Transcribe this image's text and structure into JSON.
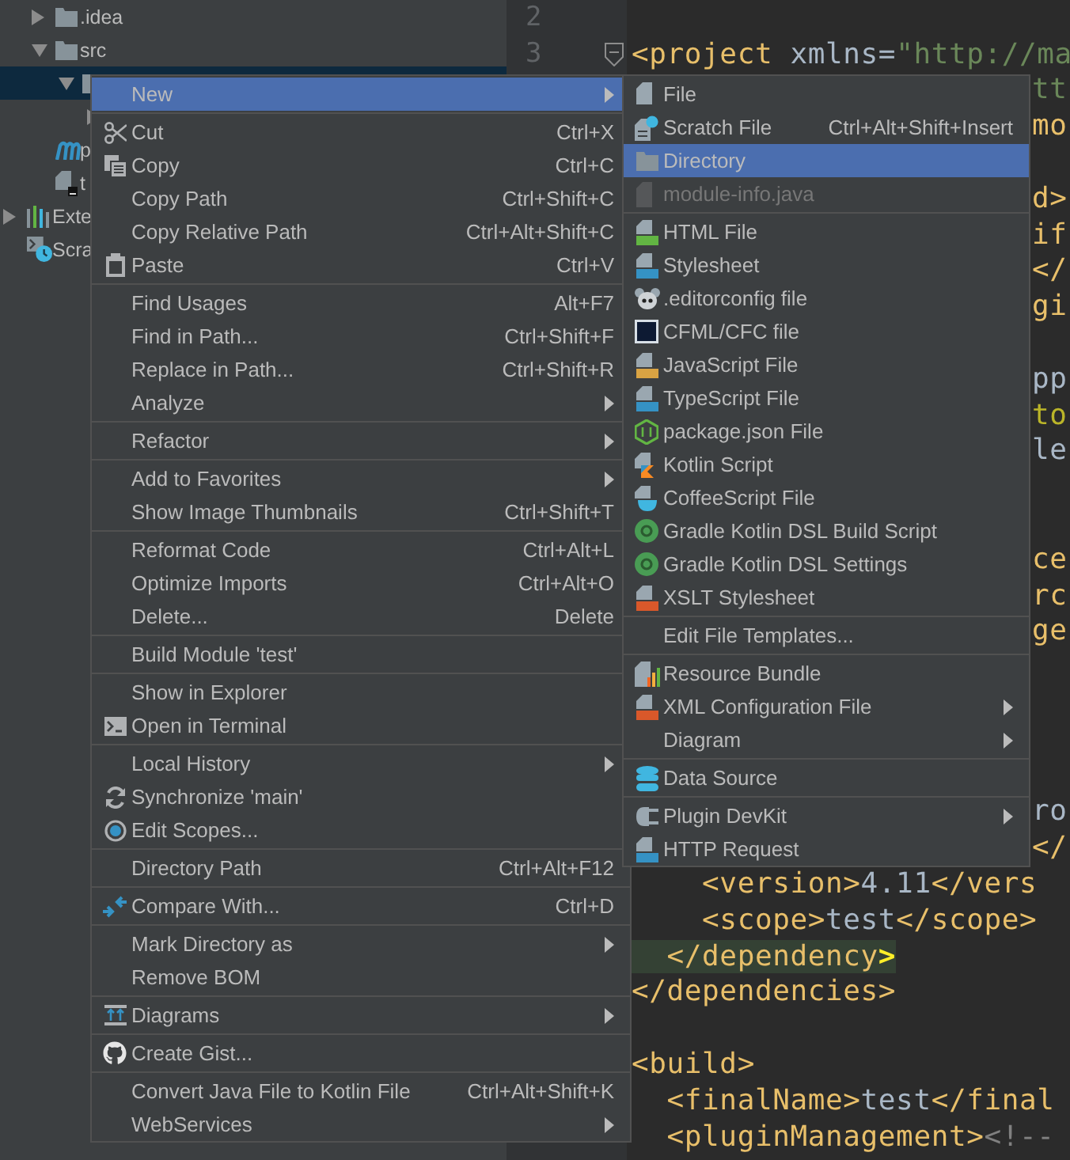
{
  "project_tree": {
    "items": [
      {
        "label": ".idea",
        "kind": "folder",
        "expanded": false,
        "selected": false
      },
      {
        "label": "src",
        "kind": "folder",
        "expanded": true,
        "selected": false,
        "children": [
          {
            "kind": "folder",
            "expanded": true,
            "selected": true,
            "children": [
              {
                "expanded": false,
                "selected": false
              }
            ]
          }
        ]
      },
      {
        "label": "p",
        "kind": "maven",
        "selected": false
      },
      {
        "label": "t",
        "kind": "module",
        "selected": false
      }
    ],
    "roots": [
      {
        "label": "Exte",
        "kind": "libraries",
        "expanded": false,
        "selected": false
      },
      {
        "label": "Scra",
        "kind": "scratches",
        "selected": false
      }
    ]
  },
  "editor": {
    "lines": [
      {
        "number": "2"
      },
      {
        "number": "3",
        "fold": true,
        "segments": [
          {
            "kind": "tag",
            "text": "<project"
          },
          {
            "kind": "text",
            "text": " xmlns="
          },
          {
            "kind": "string",
            "text": "\"http://ma"
          }
        ]
      },
      {
        "kind": "peek",
        "segments": [
          {
            "kind": "string",
            "text": "tt"
          }
        ]
      },
      {
        "kind": "peek",
        "segments": [
          {
            "kind": "tag",
            "text": "mo"
          }
        ]
      },
      {
        "kind": "blank"
      },
      {
        "kind": "peek",
        "segments": [
          {
            "kind": "tag",
            "text": "d>"
          }
        ]
      },
      {
        "kind": "peek",
        "segments": [
          {
            "kind": "tag",
            "text": "if"
          }
        ]
      },
      {
        "kind": "peek",
        "segments": [
          {
            "kind": "tag",
            "text": "</"
          }
        ]
      },
      {
        "kind": "peek",
        "segments": [
          {
            "kind": "tag",
            "text": "gi"
          }
        ]
      },
      {
        "kind": "blank"
      },
      {
        "kind": "peek",
        "segments": [
          {
            "kind": "text",
            "text": "pp"
          }
        ]
      },
      {
        "kind": "peek",
        "segments": [
          {
            "kind": "entity",
            "text": "to"
          }
        ]
      },
      {
        "kind": "peek",
        "segments": [
          {
            "kind": "text",
            "text": "le"
          }
        ]
      },
      {
        "kind": "blank"
      },
      {
        "kind": "blank"
      },
      {
        "kind": "peek",
        "segments": [
          {
            "kind": "tag",
            "text": "ce"
          }
        ]
      },
      {
        "kind": "peek",
        "segments": [
          {
            "kind": "tag",
            "text": "rc"
          }
        ]
      },
      {
        "kind": "peek",
        "segments": [
          {
            "kind": "tag",
            "text": "ge"
          }
        ]
      },
      {
        "kind": "blank"
      },
      {
        "kind": "blank"
      },
      {
        "kind": "blank"
      },
      {
        "kind": "blank"
      },
      {
        "kind": "peek",
        "segments": [
          {
            "kind": "text",
            "text": "ro"
          }
        ]
      },
      {
        "kind": "peek",
        "segments": [
          {
            "kind": "tag",
            "text": "</"
          }
        ]
      },
      {
        "segments": [
          {
            "kind": "tag",
            "text": "    <version>"
          },
          {
            "kind": "text",
            "text": "4.11"
          },
          {
            "kind": "tag",
            "text": "</vers"
          }
        ]
      },
      {
        "segments": [
          {
            "kind": "tag",
            "text": "    <scope>"
          },
          {
            "kind": "text",
            "text": "test"
          },
          {
            "kind": "tag",
            "text": "</scope>"
          }
        ]
      },
      {
        "highlighted": true,
        "segments": [
          {
            "kind": "tag",
            "text": "  </dependency"
          },
          {
            "kind": "match",
            "text": ">"
          }
        ]
      },
      {
        "segments": [
          {
            "kind": "tag",
            "text": "</dependencies>"
          }
        ]
      },
      {
        "kind": "blank"
      },
      {
        "segments": [
          {
            "kind": "tag",
            "text": "<build>"
          }
        ]
      },
      {
        "segments": [
          {
            "kind": "tag",
            "text": "  <finalName>"
          },
          {
            "kind": "text",
            "text": "test"
          },
          {
            "kind": "tag",
            "text": "</final"
          }
        ]
      },
      {
        "segments": [
          {
            "kind": "tag",
            "text": "  <pluginManagement>"
          },
          {
            "kind": "comment",
            "text": "<!--"
          }
        ]
      }
    ]
  },
  "context_menu": {
    "items": [
      {
        "label": "New",
        "submenu": true,
        "selected": true
      },
      {
        "kind": "separator"
      },
      {
        "label": "Cut",
        "shortcut": "Ctrl+X",
        "submenu": false,
        "selected": false
      },
      {
        "label": "Copy",
        "shortcut": "Ctrl+C",
        "submenu": false,
        "selected": false
      },
      {
        "label": "Copy Path",
        "shortcut": "Ctrl+Shift+C",
        "submenu": false,
        "selected": false
      },
      {
        "label": "Copy Relative Path",
        "shortcut": "Ctrl+Alt+Shift+C",
        "submenu": false,
        "selected": false
      },
      {
        "label": "Paste",
        "shortcut": "Ctrl+V",
        "submenu": false,
        "selected": false
      },
      {
        "kind": "separator"
      },
      {
        "label": "Find Usages",
        "shortcut": "Alt+F7",
        "submenu": false,
        "selected": false
      },
      {
        "label": "Find in Path...",
        "shortcut": "Ctrl+Shift+F",
        "submenu": false,
        "selected": false
      },
      {
        "label": "Replace in Path...",
        "shortcut": "Ctrl+Shift+R",
        "submenu": false,
        "selected": false
      },
      {
        "label": "Analyze",
        "submenu": true,
        "selected": false
      },
      {
        "kind": "separator"
      },
      {
        "label": "Refactor",
        "submenu": true,
        "selected": false
      },
      {
        "kind": "separator"
      },
      {
        "label": "Add to Favorites",
        "submenu": true,
        "selected": false
      },
      {
        "label": "Show Image Thumbnails",
        "shortcut": "Ctrl+Shift+T",
        "submenu": false,
        "selected": false
      },
      {
        "kind": "separator"
      },
      {
        "label": "Reformat Code",
        "shortcut": "Ctrl+Alt+L",
        "submenu": false,
        "selected": false
      },
      {
        "label": "Optimize Imports",
        "shortcut": "Ctrl+Alt+O",
        "submenu": false,
        "selected": false
      },
      {
        "label": "Delete...",
        "shortcut": "Delete",
        "submenu": false,
        "selected": false
      },
      {
        "kind": "separator"
      },
      {
        "label": "Build Module 'test'",
        "submenu": false,
        "selected": false
      },
      {
        "kind": "separator"
      },
      {
        "label": "Show in Explorer",
        "submenu": false,
        "selected": false
      },
      {
        "label": "Open in Terminal",
        "submenu": false,
        "selected": false
      },
      {
        "kind": "separator"
      },
      {
        "label": "Local History",
        "submenu": true,
        "selected": false
      },
      {
        "label": "Synchronize 'main'",
        "submenu": false,
        "selected": false
      },
      {
        "label": "Edit Scopes...",
        "submenu": false,
        "selected": false
      },
      {
        "kind": "separator"
      },
      {
        "label": "Directory Path",
        "shortcut": "Ctrl+Alt+F12",
        "submenu": false,
        "selected": false
      },
      {
        "kind": "separator"
      },
      {
        "label": "Compare With...",
        "shortcut": "Ctrl+D",
        "submenu": false,
        "selected": false
      },
      {
        "kind": "separator"
      },
      {
        "label": "Mark Directory as",
        "submenu": true,
        "selected": false
      },
      {
        "label": "Remove BOM",
        "submenu": false,
        "selected": false
      },
      {
        "kind": "separator"
      },
      {
        "label": "Diagrams",
        "submenu": true,
        "selected": false
      },
      {
        "kind": "separator"
      },
      {
        "label": "Create Gist...",
        "submenu": false,
        "selected": false
      },
      {
        "kind": "separator"
      },
      {
        "label": "Convert Java File to Kotlin File",
        "shortcut": "Ctrl+Alt+Shift+K",
        "submenu": false,
        "selected": false
      },
      {
        "label": "WebServices",
        "submenu": true,
        "selected": false
      }
    ]
  },
  "new_submenu": {
    "items": [
      {
        "label": "File",
        "submenu": false,
        "selected": false,
        "disabled": false
      },
      {
        "label": "Scratch File",
        "shortcut": "Ctrl+Alt+Shift+Insert",
        "submenu": false,
        "selected": false,
        "disabled": false
      },
      {
        "label": "Directory",
        "submenu": false,
        "selected": true,
        "disabled": false
      },
      {
        "label": "module-info.java",
        "submenu": false,
        "selected": false,
        "disabled": true
      },
      {
        "kind": "separator"
      },
      {
        "label": "HTML File",
        "submenu": false,
        "selected": false,
        "disabled": false
      },
      {
        "label": "Stylesheet",
        "submenu": false,
        "selected": false,
        "disabled": false
      },
      {
        "label": ".editorconfig file",
        "submenu": false,
        "selected": false,
        "disabled": false
      },
      {
        "label": "CFML/CFC file",
        "submenu": false,
        "selected": false,
        "disabled": false
      },
      {
        "label": "JavaScript File",
        "submenu": false,
        "selected": false,
        "disabled": false
      },
      {
        "label": "TypeScript File",
        "submenu": false,
        "selected": false,
        "disabled": false
      },
      {
        "label": "package.json File",
        "submenu": false,
        "selected": false,
        "disabled": false
      },
      {
        "label": "Kotlin Script",
        "submenu": false,
        "selected": false,
        "disabled": false
      },
      {
        "label": "CoffeeScript File",
        "submenu": false,
        "selected": false,
        "disabled": false
      },
      {
        "label": "Gradle Kotlin DSL Build Script",
        "submenu": false,
        "selected": false,
        "disabled": false
      },
      {
        "label": "Gradle Kotlin DSL Settings",
        "submenu": false,
        "selected": false,
        "disabled": false
      },
      {
        "label": "XSLT Stylesheet",
        "submenu": false,
        "selected": false,
        "disabled": false
      },
      {
        "kind": "separator"
      },
      {
        "label": "Edit File Templates...",
        "submenu": false,
        "selected": false,
        "disabled": false
      },
      {
        "kind": "separator"
      },
      {
        "label": "Resource Bundle",
        "submenu": false,
        "selected": false,
        "disabled": false
      },
      {
        "label": "XML Configuration File",
        "submenu": true,
        "selected": false,
        "disabled": false
      },
      {
        "label": "Diagram",
        "submenu": true,
        "selected": false,
        "disabled": false
      },
      {
        "kind": "separator"
      },
      {
        "label": "Data Source",
        "submenu": false,
        "selected": false,
        "disabled": false
      },
      {
        "kind": "separator"
      },
      {
        "label": "Plugin DevKit",
        "submenu": true,
        "selected": false,
        "disabled": false
      },
      {
        "label": "HTTP Request",
        "submenu": false,
        "selected": false,
        "disabled": false
      }
    ]
  }
}
